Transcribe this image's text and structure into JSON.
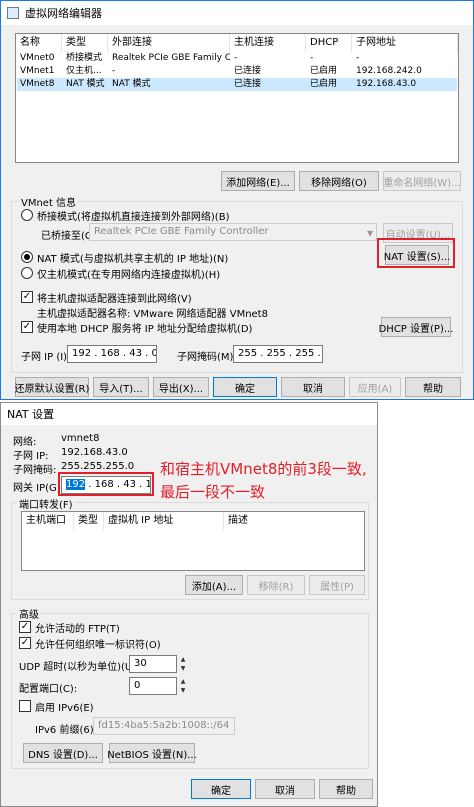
{
  "editor": {
    "title": "虚拟网络编辑器",
    "columns": [
      "名称",
      "类型",
      "外部连接",
      "主机连接",
      "DHCP",
      "子网地址"
    ],
    "rows": [
      [
        "VMnet0",
        "桥接模式",
        "Realtek PCIe GBE Family Co...",
        "-",
        "-",
        "-"
      ],
      [
        "VMnet1",
        "仅主机...",
        "-",
        "已连接",
        "已启用",
        "192.168.242.0"
      ],
      [
        "VMnet8",
        "NAT 模式",
        "NAT 模式",
        "已连接",
        "已启用",
        "192.168.43.0"
      ]
    ],
    "selected_row": 2,
    "list_buttons": {
      "add": "添加网络(E)...",
      "remove": "移除网络(O)",
      "rename": "重命名网络(W)..."
    },
    "info_title": "VMnet 信息",
    "bridge_radio": "桥接模式(将虚拟机直接连接到外部网络)(B)",
    "bridge_to_label": "已桥接至(G):",
    "bridge_to_value": "Realtek PCIe GBE Family Controller",
    "auto_settings": "自动设置(U)...",
    "nat_radio": "NAT 模式(与虚拟机共享主机的 IP 地址)(N)",
    "nat_settings": "NAT 设置(S)...",
    "hostonly_radio": "仅主机模式(在专用网络内连接虚拟机)(H)",
    "connect_adapter": "将主机虚拟适配器连接到此网络(V)",
    "adapter_name": "主机虚拟适配器名称: VMware 网络适配器 VMnet8",
    "use_dhcp": "使用本地 DHCP 服务将 IP 地址分配给虚拟机(D)",
    "dhcp_settings": "DHCP 设置(P)...",
    "subnet_ip_label": "子网 IP (I):",
    "subnet_ip": "192 . 168 . 43 . 0",
    "subnet_mask_label": "子网掩码(M):",
    "subnet_mask": "255 . 255 . 255 . 0",
    "bottom_buttons": {
      "restore": "还原默认设置(R)",
      "import": "导入(T)...",
      "export": "导出(X)...",
      "ok": "确定",
      "cancel": "取消",
      "apply": "应用(A)",
      "help": "帮助"
    }
  },
  "nat": {
    "title": "NAT 设置",
    "network_label": "网络:",
    "network_value": "vmnet8",
    "subnet_ip_label": "子网 IP:",
    "subnet_ip_value": "192.168.43.0",
    "subnet_mask_label": "子网掩码:",
    "subnet_mask_value": "255.255.255.0",
    "gateway_label": "网关 IP(G):",
    "gateway_value": {
      "selected": "192",
      "rest": " . 168 . 43 . 1"
    },
    "port_forward_title": "端口转发(F)",
    "pf_columns": [
      "主机端口",
      "类型",
      "虚拟机 IP 地址",
      "描述"
    ],
    "pf_buttons": {
      "add": "添加(A)...",
      "remove": "移除(R)",
      "props": "属性(P)"
    },
    "advanced_title": "高级",
    "allow_ftp": "允许活动的 FTP(T)",
    "allow_oui": "允许任何组织唯一标识符(O)",
    "udp_label": "UDP 超时(以秒为单位)(U):",
    "udp_value": "30",
    "config_port_label": "配置端口(C):",
    "config_port_value": "0",
    "enable_ipv6": "启用 IPv6(E)",
    "ipv6_prefix_label": "IPv6 前缀(6):",
    "ipv6_prefix_value": "fd15:4ba5:5a2b:1008::/64",
    "dns_settings": "DNS 设置(D)...",
    "netbios_settings": "NetBIOS 设置(N)...",
    "ok": "确定",
    "cancel": "取消",
    "help": "帮助"
  },
  "annotation": {
    "line1": "和宿主机VMnet8的前3段一致,",
    "line2": "最后一段不一致",
    "color": "#e0202a"
  }
}
